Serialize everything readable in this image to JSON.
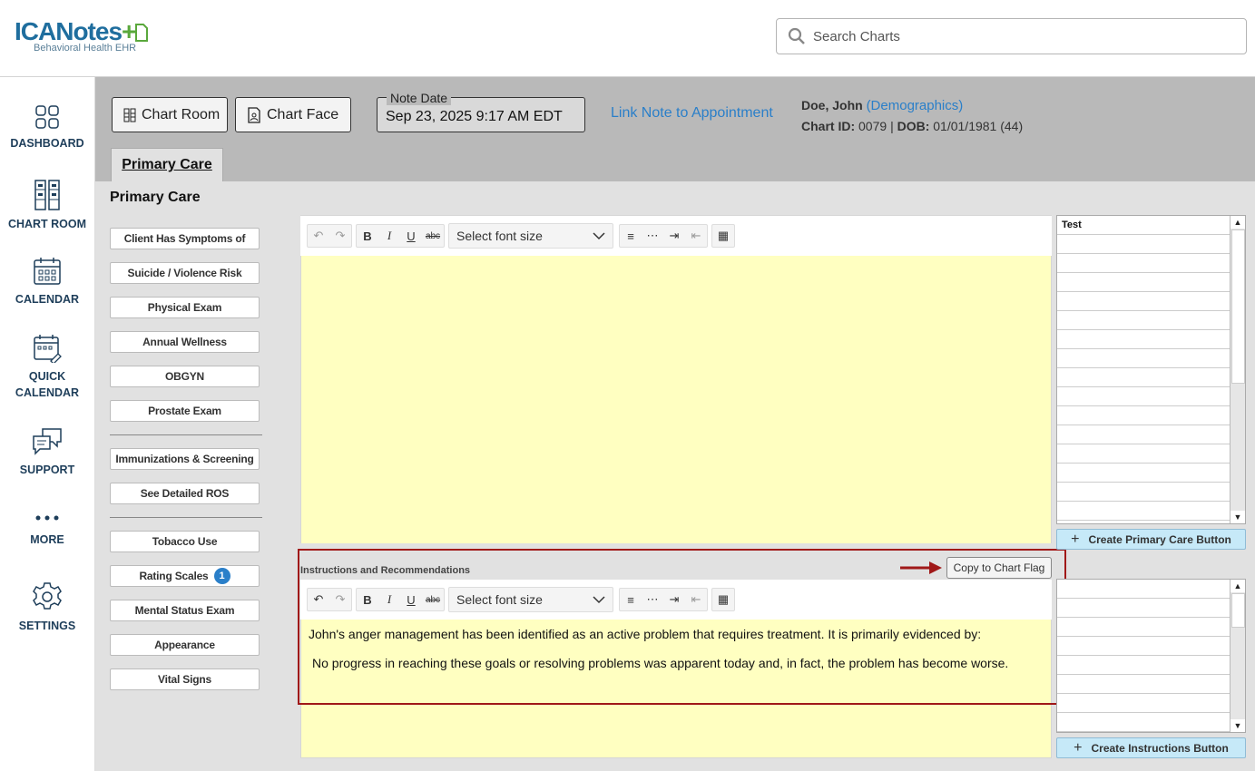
{
  "brand": {
    "name_a": "ICA",
    "name_b": "Notes",
    "tagline": "Behavioral Health EHR"
  },
  "search": {
    "placeholder": "Search Charts"
  },
  "nav": [
    {
      "label": "DASHBOARD",
      "icon": "dashboard-icon"
    },
    {
      "label": "CHART ROOM",
      "icon": "chart-room-icon"
    },
    {
      "label": "CALENDAR",
      "icon": "calendar-icon"
    },
    {
      "label": "QUICK",
      "label2": "CALENDAR",
      "icon": "quick-calendar-icon"
    },
    {
      "label": "SUPPORT",
      "icon": "support-icon"
    },
    {
      "label": "MORE",
      "icon": "more-icon"
    },
    {
      "label": "SETTINGS",
      "icon": "gear-icon"
    }
  ],
  "header": {
    "chart_room": "Chart Room",
    "chart_face": "Chart Face",
    "note_date_label": "Note Date",
    "note_date_value": "Sep 23, 2025 9:17 AM EDT",
    "link_note": "Link Note to Appointment",
    "patient_name": "Doe, John",
    "demographics": "(Demographics)",
    "chart_id_label": "Chart ID:",
    "chart_id": "0079",
    "separator": "|",
    "dob_label": "DOB:",
    "dob": "01/01/1981 (44)"
  },
  "tab": {
    "label": "Primary Care"
  },
  "section": {
    "title": "Primary Care"
  },
  "left_buttons": [
    "Client Has Symptoms of",
    "Suicide / Violence Risk",
    "Physical Exam",
    "Annual Wellness",
    "OBGYN",
    "Prostate Exam",
    "Immunizations & Screening",
    "See Detailed ROS",
    "Tobacco Use",
    "Rating Scales",
    "Mental Status Exam",
    "Appearance",
    "Vital Signs"
  ],
  "rating_badge": "1",
  "toolbar": {
    "bold": "B",
    "italic": "I",
    "underline": "U",
    "strike": "abc",
    "font_size_placeholder": "Select font size"
  },
  "instructions": {
    "label": "Instructions and Recommendations",
    "copy_button": "Copy to Chart Flag",
    "para1": "John's anger management has been identified as an active problem that requires treatment. It is primarily evidenced by:",
    "para2": "No progress in reaching these goals or resolving  problems was apparent today and, in fact, the problem has become worse."
  },
  "right_panel": {
    "list1_header": "Test",
    "create_primary": "Create Primary Care Button",
    "create_instructions": "Create Instructions Button"
  },
  "colors": {
    "accent": "#2a7fc9",
    "editor_bg": "#ffffc1",
    "highlight_border": "#a01818",
    "create_btn": "#c6e9f8"
  }
}
